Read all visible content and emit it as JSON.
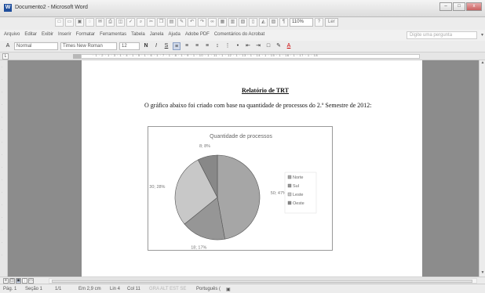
{
  "window": {
    "title": "Documento2 - Microsoft Word",
    "minimize_label": "–",
    "maximize_label": "□",
    "close_label": "x"
  },
  "toolbar": {
    "zoom": "110%",
    "read_label": "Ler"
  },
  "menu": {
    "items": [
      "Arquivo",
      "Editar",
      "Exibir",
      "Inserir",
      "Formatar",
      "Ferramentas",
      "Tabela",
      "Janela",
      "Ajuda",
      "Adobe PDF",
      "Comentários do Acrobat"
    ],
    "help_placeholder": "Digite uma pergunta"
  },
  "formatting": {
    "style": "Normal",
    "font": "Times New Roman",
    "size": "12",
    "bold": "N",
    "italic": "I",
    "underline": "S",
    "font_color": "A"
  },
  "ruler": {
    "numbers": "· 1 · 2 · 1 · 3 · 1 · 4 · 1 · 5 · 1 · 6 · 1 · 7 · 1 · 8 · 1 · 9 · 1 · 10 · 1 · 11 · 1 · 12 · 1 · 13 · 1 · 14 · 1 · 15 · 1 · 16 · 1 · 17 · 1 · 18"
  },
  "document": {
    "title": "Relatório de TRT",
    "paragraph": "O gráfico abaixo foi criado com base na quantidade de processos do 2.º Semestre de 2012:"
  },
  "chart_data": {
    "type": "pie",
    "title": "Quantidade de processos",
    "categories": [
      "Norte",
      "Sul",
      "Leste",
      "Oeste"
    ],
    "values": [
      50,
      18,
      30,
      8
    ],
    "percent_labels": [
      "47%",
      "17%",
      "28%",
      "8%"
    ],
    "data_labels": [
      "50; 47%",
      "18; 17%",
      "30; 28%",
      "8; 8%"
    ],
    "colors": [
      "#a6a6a6",
      "#969696",
      "#c8c8c8",
      "#888888"
    ],
    "legend_position": "right"
  },
  "status": {
    "page": "Pág. 1",
    "section": "Seção 1",
    "pages": "1/1",
    "position": "Em 2,9 cm",
    "line": "Lin 4",
    "column": "Col 11",
    "modes": "GRA   ALT   EST   SE",
    "language": "Português ("
  }
}
